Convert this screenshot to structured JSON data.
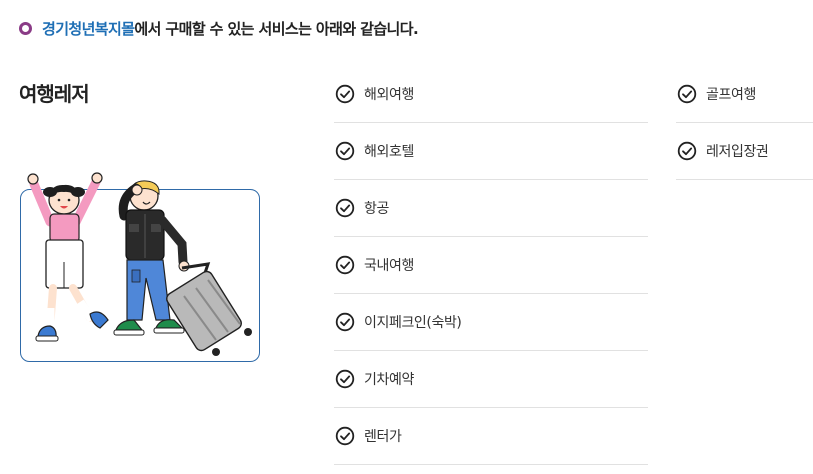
{
  "intro": {
    "brand": "경기청년복지몰",
    "text": "에서 구매할 수 있는 서비스는 아래와 같습니다."
  },
  "category": {
    "title": "여행레저"
  },
  "services": {
    "column1": [
      {
        "label": "해외여행"
      },
      {
        "label": "해외호텔"
      },
      {
        "label": "항공"
      },
      {
        "label": "국내여행"
      },
      {
        "label": "이지페크인(숙박)"
      },
      {
        "label": "기차예약"
      },
      {
        "label": "렌터가"
      }
    ],
    "column2": [
      {
        "label": "골프여행"
      },
      {
        "label": "레저입장권"
      }
    ]
  },
  "icons": {
    "bullet": "circle-bullet-icon",
    "check": "check-circle-icon"
  },
  "colors": {
    "brand": "#1f6fb5",
    "bullet": "#8a3b86",
    "divider": "#e1e1e1",
    "illustration_border": "#2f6aa8"
  }
}
